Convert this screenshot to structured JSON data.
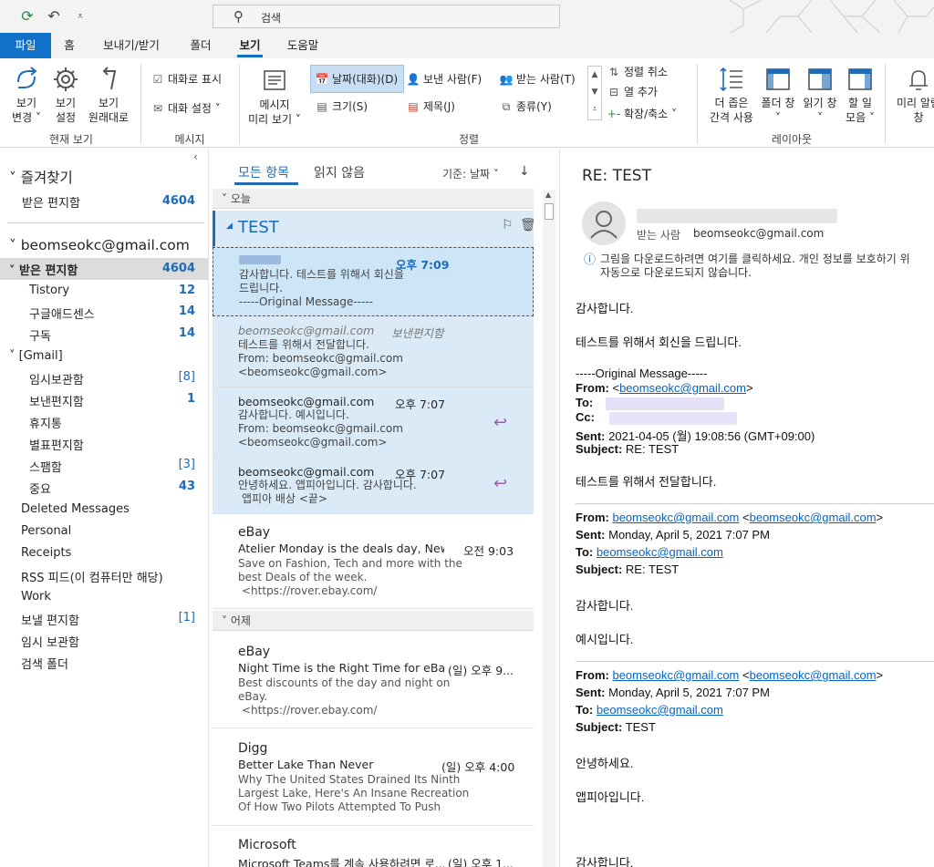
{
  "qat": {
    "sync_icon": "sync-icon",
    "undo_icon": "undo-icon",
    "dropdown_icon": "customize-dropdown-icon"
  },
  "search": {
    "placeholder": "검색"
  },
  "tabs": [
    {
      "label": "파일"
    },
    {
      "label": "홈"
    },
    {
      "label": "보내기/받기"
    },
    {
      "label": "폴더"
    },
    {
      "label": "보기"
    },
    {
      "label": "도움말"
    }
  ],
  "ribbon": {
    "current_view": {
      "group_label": "현재 보기",
      "change_view": [
        "보기",
        "변경 ˅"
      ],
      "view_settings": [
        "보기",
        "설정"
      ],
      "reset_view": [
        "보기",
        "원래대로"
      ]
    },
    "messages": {
      "group_label": "메시지",
      "show_as_conversations": "대화로 표시",
      "conversation_settings": "대화 설정 ˅"
    },
    "arrangement": {
      "group_label": "정렬",
      "message_preview": [
        "메시지",
        "미리 보기 ˅"
      ],
      "date": "날짜(대화)(D)",
      "from": "보낸 사람(F)",
      "to": "받는 사람(T)",
      "size": "크기(S)",
      "subject": "제목(J)",
      "type": "종류(Y)",
      "reverse_sort": "정렬 취소",
      "add_columns": "열 추가",
      "expand_collapse": "확장/축소 ˅"
    },
    "layout": {
      "group_label": "레이아웃",
      "spacing": [
        "더 좁은",
        "간격 사용"
      ],
      "folder_pane": [
        "폴더 창",
        "˅"
      ],
      "reading_pane": [
        "읽기 창",
        "˅"
      ],
      "todo_bar": [
        "할 일",
        "모음 ˅"
      ],
      "preview": [
        "미리 알림",
        "창"
      ]
    }
  },
  "folders": {
    "favorites": "즐겨찾기",
    "favorites_items": [
      {
        "name": "받은 편지함",
        "count": "4604"
      }
    ],
    "account": "beomseokc@gmail.com",
    "inbox": {
      "name": "받은 편지함",
      "count": "4604"
    },
    "inbox_sub": [
      {
        "name": "Tistory",
        "count": "12"
      },
      {
        "name": "구글애드센스",
        "count": "14"
      },
      {
        "name": "구독",
        "count": "14"
      }
    ],
    "gmail": "[Gmail]",
    "gmail_sub": [
      {
        "name": "임시보관함",
        "count": "[8]"
      },
      {
        "name": "보낸편지함",
        "count": "1"
      },
      {
        "name": "휴지통",
        "count": ""
      },
      {
        "name": "별표편지함",
        "count": ""
      },
      {
        "name": "스팸함",
        "count": "[3]"
      },
      {
        "name": "중요",
        "count": "43"
      }
    ],
    "others": [
      {
        "name": "Deleted Messages",
        "count": ""
      },
      {
        "name": "Personal",
        "count": ""
      },
      {
        "name": "Receipts",
        "count": ""
      },
      {
        "name": "RSS 피드(이 컴퓨터만 해당)",
        "count": ""
      },
      {
        "name": "Work",
        "count": ""
      },
      {
        "name": "보낼 편지함",
        "count": "[1]"
      },
      {
        "name": "임시 보관함",
        "count": ""
      },
      {
        "name": "검색 폴더",
        "count": ""
      }
    ]
  },
  "list": {
    "tab_all": "모든 항목",
    "tab_unread": "읽지 않음",
    "sort": "기준: 날짜 ˅",
    "sort_arrow": "↓",
    "group_today": "오늘",
    "group_yesterday": "어제",
    "conversation_title": "TEST",
    "items": [
      {
        "from": "",
        "time": "오후 7:09",
        "lines": [
          "감사합니다.   테스트를 위해서 회신을",
          "드립니다.",
          "-----Original Message-----"
        ]
      },
      {
        "from": "beomseokc@gmail.com",
        "time": "보낸편지함",
        "lines": [
          "테스트를 위해서 전달합니다.",
          "From: beomseokc@gmail.com",
          "<beomseokc@gmail.com>"
        ]
      },
      {
        "from": "beomseokc@gmail.com",
        "time": "오후 7:07",
        "lines": [
          "감사합니다.   예시입니다.",
          "From: beomseokc@gmail.com",
          "<beomseokc@gmail.com>"
        ]
      },
      {
        "from": "beomseokc@gmail.com",
        "time": "오후 7:07",
        "lines": [
          "안녕하세요.  앱피아입니다.   감사합니다.",
          "앱피아 배상  <끝>"
        ]
      },
      {
        "from": "eBay",
        "subject": "Atelier Monday is the deals day, New pr...",
        "time": "오전 9:03",
        "lines": [
          "Save on Fashion, Tech and more with the",
          "best Deals of the week.",
          "<https://rover.ebay.com/"
        ]
      },
      {
        "from": "eBay",
        "subject": "Night Time is the Right Time for eBay D...",
        "time": "(일) 오후 9...",
        "lines": [
          "Best discounts of the day and night on",
          "eBay.",
          "<https://rover.ebay.com/"
        ]
      },
      {
        "from": "Digg",
        "subject": "Better Lake Than Never",
        "time": "(일) 오후 4:00",
        "lines": [
          "Why The United States Drained Its Ninth",
          "Largest Lake, Here's An Insane Recreation",
          "Of How Two Pilots Attempted To Push"
        ]
      },
      {
        "from": "Microsoft",
        "subject": "Microsoft Teams를 계속 사용하려면 로...",
        "time": "(일) 오후 1...",
        "lines": []
      }
    ]
  },
  "reading": {
    "subject": "RE: TEST",
    "to_label": "받는 사람",
    "to_value": "beomseokc@gmail.com",
    "info": [
      "그림을 다운로드하려면 여기를 클릭하세요. 개인 정보를 보호하기 위",
      "자동으로 다운로드되지 않습니다."
    ],
    "body1": "감사합니다.",
    "body2": "테스트를 위해서 회신을 드립니다.",
    "orig": "-----Original Message-----",
    "from_label": "From:",
    "from_lt": "<",
    "from_email": "beomseokc@gmail.com",
    "from_gt": ">",
    "to_label2": "To:",
    "cc_label": "Cc:",
    "sent_label": "Sent:",
    "sent_value": "2021-04-05 (월) 19:08:56 (GMT+09:00)",
    "subject_label": "Subject:",
    "subject_value": "RE: TEST",
    "body3": "테스트를 위해서 전달합니다.",
    "b2_from_email": "beomseokc@gmail.com",
    "b2_from_lt": "<",
    "b2_from_email2": "beomseokc@gmail.com",
    "b2_from_gt": ">",
    "b2_sent": "Monday, April 5, 2021 7:07 PM",
    "b2_to": "beomseokc@gmail.com",
    "b2_subject": "RE: TEST",
    "body4": "감사합니다.",
    "body5": "예시입니다.",
    "b3_from_email": "beomseokc@gmail.com",
    "b3_from_lt": "<",
    "b3_from_email2": "beomseokc@gmail.com",
    "b3_from_gt": ">",
    "b3_sent": "Monday, April 5, 2021 7:07 PM",
    "b3_to": "beomseokc@gmail.com",
    "b3_subject": "TEST",
    "body6": "안녕하세요.",
    "body7": "앱피아입니다.",
    "body8": "감사합니다."
  }
}
